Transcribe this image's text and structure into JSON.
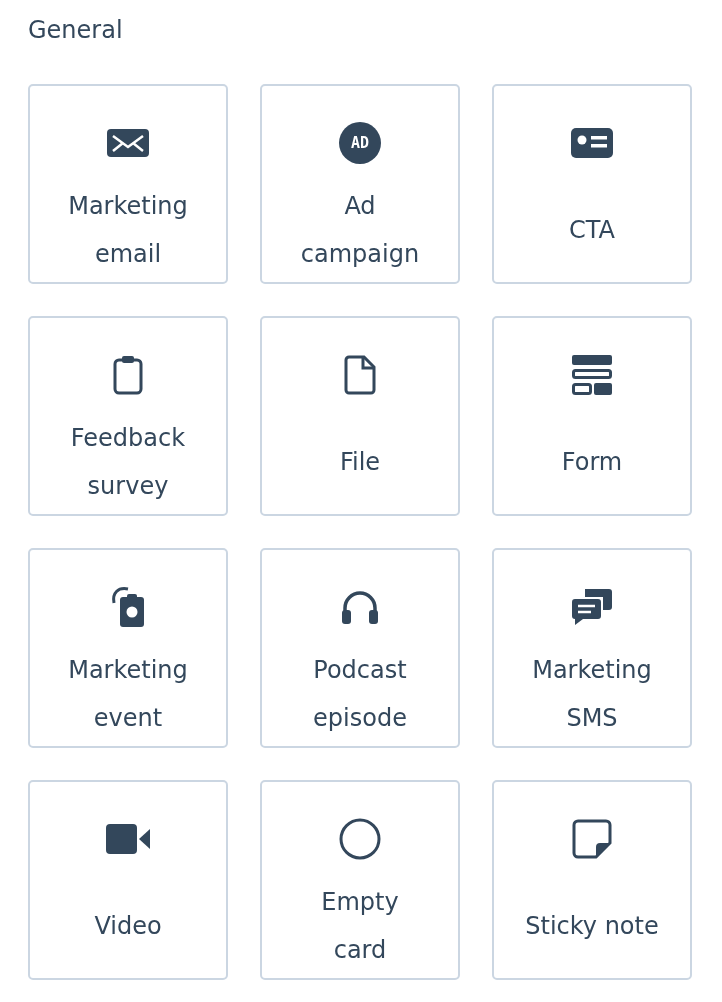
{
  "section": {
    "title": "General"
  },
  "cards": [
    {
      "kind": "email",
      "lines": [
        "Marketing",
        "email"
      ]
    },
    {
      "kind": "ad",
      "badge": "AD",
      "lines": [
        "Ad",
        "campaign"
      ]
    },
    {
      "kind": "cta",
      "lines": [
        "CTA"
      ]
    },
    {
      "kind": "clipboard",
      "lines": [
        "Feedback",
        "survey"
      ]
    },
    {
      "kind": "file",
      "lines": [
        "File"
      ]
    },
    {
      "kind": "form",
      "lines": [
        "Form"
      ]
    },
    {
      "kind": "event",
      "lines": [
        "Marketing",
        "event"
      ]
    },
    {
      "kind": "headphones",
      "lines": [
        "Podcast",
        "episode"
      ]
    },
    {
      "kind": "sms",
      "lines": [
        "Marketing",
        "SMS"
      ]
    },
    {
      "kind": "video",
      "lines": [
        "Video"
      ]
    },
    {
      "kind": "circle",
      "lines": [
        "Empty",
        "card"
      ]
    },
    {
      "kind": "sticky",
      "lines": [
        "Sticky note"
      ]
    }
  ]
}
